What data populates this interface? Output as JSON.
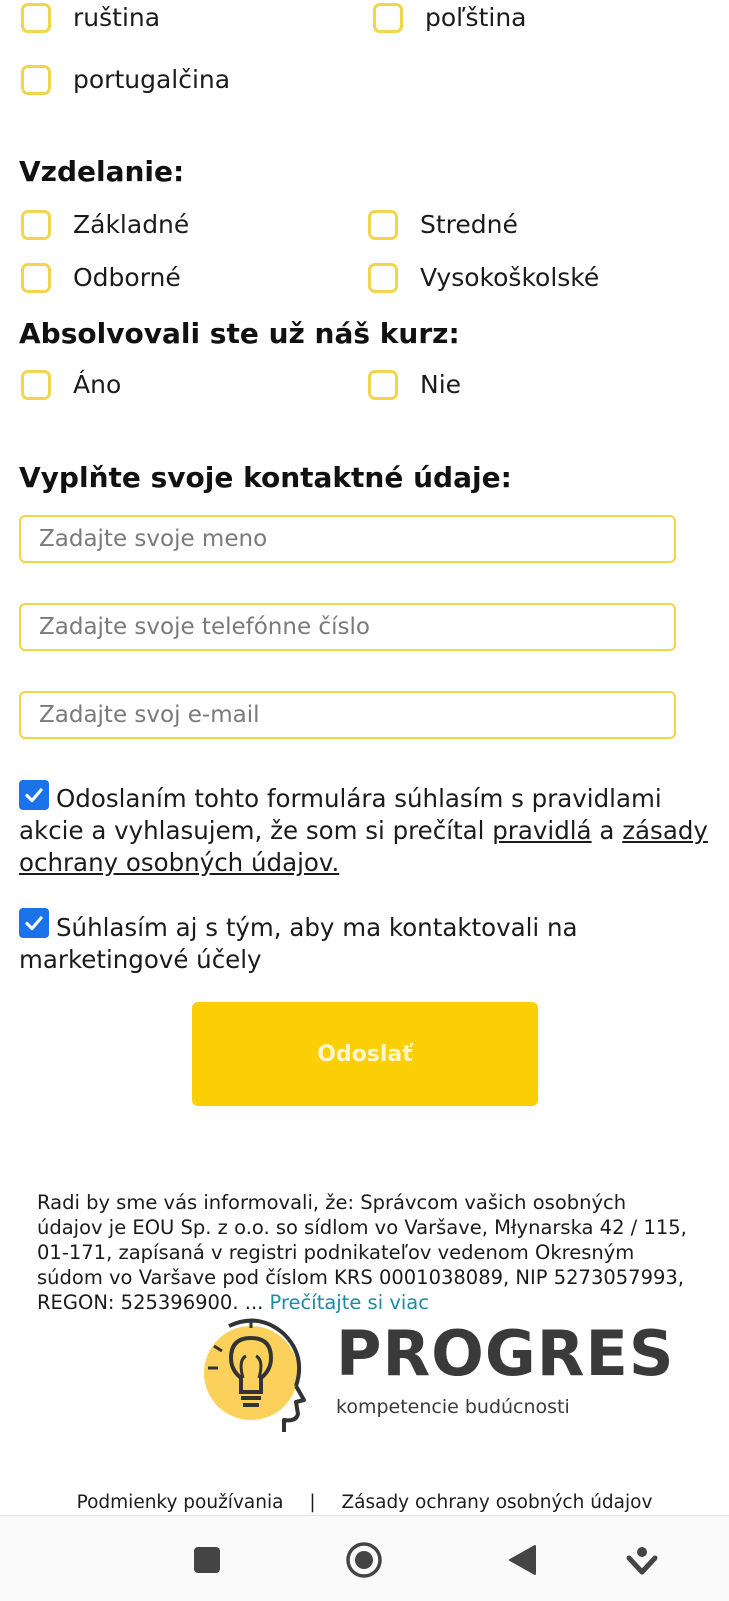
{
  "languages": {
    "items": [
      "ruština",
      "poľština",
      "portugalčina"
    ]
  },
  "education": {
    "title": "Vzdelanie:",
    "options": [
      "Základné",
      "Stredné",
      "Odborné",
      "Vysokoškolské"
    ]
  },
  "course": {
    "title": "Absolvovali ste už náš kurz:",
    "options": [
      "Áno",
      "Nie"
    ]
  },
  "contact": {
    "title": "Vyplňte svoje kontaktné údaje:",
    "name_placeholder": "Zadajte svoje meno",
    "phone_placeholder": "Zadajte svoje telefónne číslo",
    "email_placeholder": "Zadajte svoj e-mail"
  },
  "consent": {
    "rules_text": "Odoslaním tohto formulára súhlasím s pravidlami akcie a vyhlasujem, že som si prečítal",
    "rules_link": "pravidlá",
    "rules_and": "a",
    "privacy_link": "zásady ochrany osobných údajov.",
    "rules_checked": true,
    "marketing_text": "Súhlasím aj s tým, aby ma kontaktovali na marketingové účely",
    "marketing_checked": true
  },
  "submit_label": "Odoslať",
  "info": {
    "text": "Radi by sme vás informovali, že: Správcom vašich osobných údajov je EOU Sp. z o.o. so sídlom vo Varšave, Młynarska 42 / 115, 01-171, zapísaná v registri podnikateľov vedenom Okresným súdom vo Varšave pod číslom KRS 0001038089, NIP 5273057993, REGON: 525396900. ...",
    "read_more": "Prečítajte si viac"
  },
  "logo": {
    "name": "PROGRES",
    "tagline": "kompetencie budúcnosti"
  },
  "footer": {
    "terms": "Podmienky používania",
    "separator": "|",
    "privacy": "Zásady ochrany osobných údajov"
  },
  "colors": {
    "accent": "#fbcf04",
    "checkbox_border": "#f3d44d",
    "checked": "#1a73e8",
    "link": "#1e8aa8"
  }
}
